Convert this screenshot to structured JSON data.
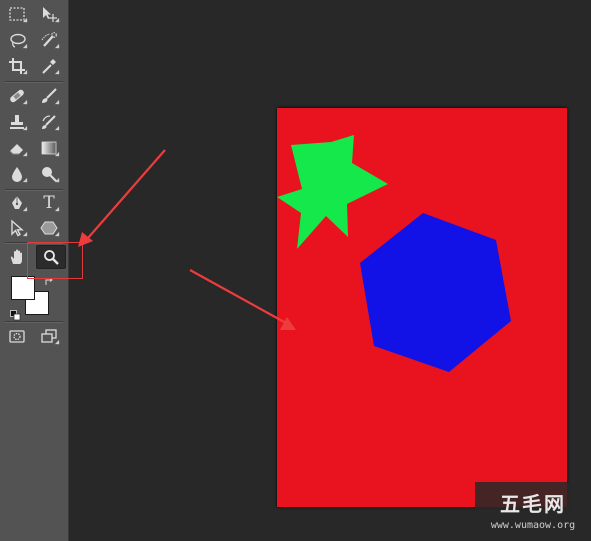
{
  "app": "Photoshop",
  "toolbar": {
    "active_tool": "zoom-tool",
    "foreground_color": "#ffffff",
    "background_color": "#ffffff",
    "tools": [
      {
        "name": "marquee-tool",
        "icon": "dashed-rect-icon"
      },
      {
        "name": "move-tool",
        "icon": "move-arrow-icon"
      },
      {
        "name": "lasso-tool",
        "icon": "lasso-icon"
      },
      {
        "name": "quick-selection-tool",
        "icon": "quick-select-brush-icon"
      },
      {
        "name": "crop-tool",
        "icon": "crop-icon"
      },
      {
        "name": "eyedropper-tool",
        "icon": "eyedropper-icon"
      },
      {
        "name": "healing-brush-tool",
        "icon": "bandage-icon"
      },
      {
        "name": "brush-tool",
        "icon": "brush-icon"
      },
      {
        "name": "clone-stamp-tool",
        "icon": "stamp-icon"
      },
      {
        "name": "history-brush-tool",
        "icon": "history-brush-icon"
      },
      {
        "name": "eraser-tool",
        "icon": "eraser-icon"
      },
      {
        "name": "gradient-tool",
        "icon": "gradient-icon"
      },
      {
        "name": "blur-tool",
        "icon": "drop-icon"
      },
      {
        "name": "dodge-tool",
        "icon": "dodge-icon"
      },
      {
        "name": "pen-tool",
        "icon": "pen-icon"
      },
      {
        "name": "type-tool",
        "icon": "type-t-icon"
      },
      {
        "name": "path-selection-tool",
        "icon": "arrow-cursor-icon"
      },
      {
        "name": "shape-tool",
        "icon": "hexagon-icon"
      },
      {
        "name": "hand-tool",
        "icon": "hand-icon"
      },
      {
        "name": "zoom-tool",
        "icon": "magnifier-icon"
      }
    ],
    "type_label": "T"
  },
  "document": {
    "background_color": "#e8131f",
    "star_color": "#14e84a",
    "hexagon_color": "#1212e6"
  },
  "annotations": {
    "arrow_color": "#ee3c3c"
  },
  "watermark": {
    "title": "五毛网",
    "url": "www.wumaow.org"
  }
}
